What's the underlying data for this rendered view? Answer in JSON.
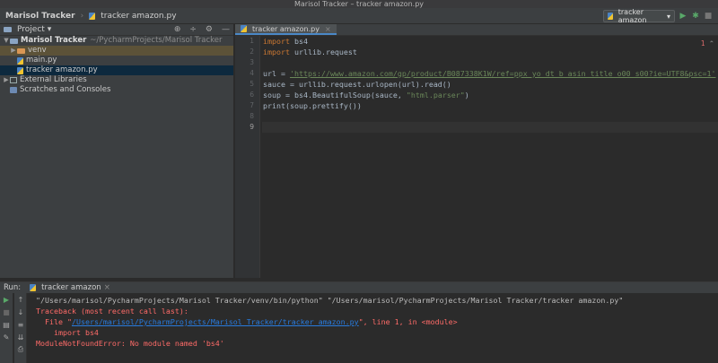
{
  "window": {
    "title": "Marisol Tracker – tracker amazon.py"
  },
  "navbar": {
    "project": "Marisol Tracker",
    "file": "tracker amazon.py",
    "run_config": "tracker amazon"
  },
  "project_panel": {
    "title": "Project",
    "root": {
      "name": "Marisol Tracker",
      "path": "~/PycharmProjects/Marisol Tracker"
    },
    "items": [
      {
        "label": "venv"
      },
      {
        "label": "main.py"
      },
      {
        "label": "tracker amazon.py"
      }
    ],
    "external": "External Libraries",
    "scratches": "Scratches and Consoles"
  },
  "editor": {
    "tab": "tracker amazon.py",
    "indicator": "1",
    "line_numbers": [
      "1",
      "2",
      "3",
      "4",
      "5",
      "6",
      "7",
      "8",
      "9"
    ],
    "lines": {
      "l1_kw": "import",
      "l1_rest": " bs4",
      "l2_kw": "import",
      "l2_rest": " urllib.request",
      "l4_a": "url = ",
      "l4_url": "'https://www.amazon.com/gp/product/B087338K1W/ref=ppx_yo_dt_b_asin_title_o00_s00?ie=UTF8&psc=1'",
      "l5": "sauce = urllib.request.urlopen(url).read()",
      "l6_a": "soup = bs4.BeautifulSoup(sauce, ",
      "l6_str": "\"html.parser\"",
      "l6_b": ")",
      "l7": "print(soup.prettify())"
    }
  },
  "run_panel": {
    "label": "Run:",
    "tab": "tracker amazon",
    "console": {
      "cmd": "\"/Users/marisol/PycharmProjects/Marisol Tracker/venv/bin/python\" \"/Users/marisol/PycharmProjects/Marisol Tracker/tracker amazon.py\"",
      "tb": "Traceback (most recent call last):",
      "file_a": "  File \"",
      "file_link": "/Users/marisol/PycharmProjects/Marisol Tracker/tracker amazon.py",
      "file_b": "\", line 1, in <module>",
      "import_line": "    import bs4",
      "error": "ModuleNotFoundError: No module named 'bs4'"
    }
  },
  "colors": {
    "accent": "#4a88c7",
    "error": "#ff6b68",
    "keyword": "#cc7832",
    "string": "#6a8759"
  }
}
